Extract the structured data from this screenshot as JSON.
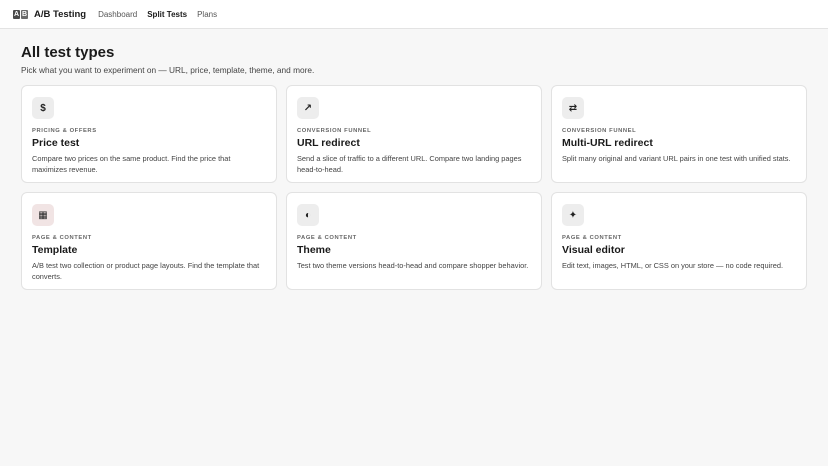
{
  "app": {
    "logo_letters": [
      "A",
      "B"
    ],
    "title": "A/B Testing"
  },
  "nav": [
    {
      "label": "Dashboard",
      "active": false
    },
    {
      "label": "Split Tests",
      "active": true
    },
    {
      "label": "Plans",
      "active": false
    }
  ],
  "page": {
    "title": "All test types",
    "subtitle": "Pick what you want to experiment on — URL, price, template, theme, and more."
  },
  "cards": [
    {
      "icon": "$",
      "icon_name": "dollar-icon",
      "category": "PRICING & OFFERS",
      "title": "Price test",
      "description": "Compare two prices on the same product. Find the price that maximizes revenue."
    },
    {
      "icon": "↗",
      "icon_name": "arrow-up-right-icon",
      "category": "CONVERSION FUNNEL",
      "title": "URL redirect",
      "description": "Send a slice of traffic to a different URL. Compare two landing pages head-to-head."
    },
    {
      "icon": "⇄",
      "icon_name": "swap-arrows-icon",
      "category": "CONVERSION FUNNEL",
      "title": "Multi-URL redirect",
      "description": "Split many original and variant URL pairs in one test with unified stats."
    },
    {
      "icon": "▦",
      "icon_name": "grid-icon",
      "category": "PAGE & CONTENT",
      "title": "Template",
      "description": "A/B test two collection or product page layouts. Find the template that converts."
    },
    {
      "icon": "◐",
      "icon_name": "half-circle-icon",
      "category": "PAGE & CONTENT",
      "title": "Theme",
      "description": "Test two theme versions head-to-head and compare shopper behavior."
    },
    {
      "icon": "✦",
      "icon_name": "sparkle-icon",
      "category": "PAGE & CONTENT",
      "title": "Visual editor",
      "description": "Edit text, images, HTML, or CSS on your store — no code required."
    }
  ]
}
